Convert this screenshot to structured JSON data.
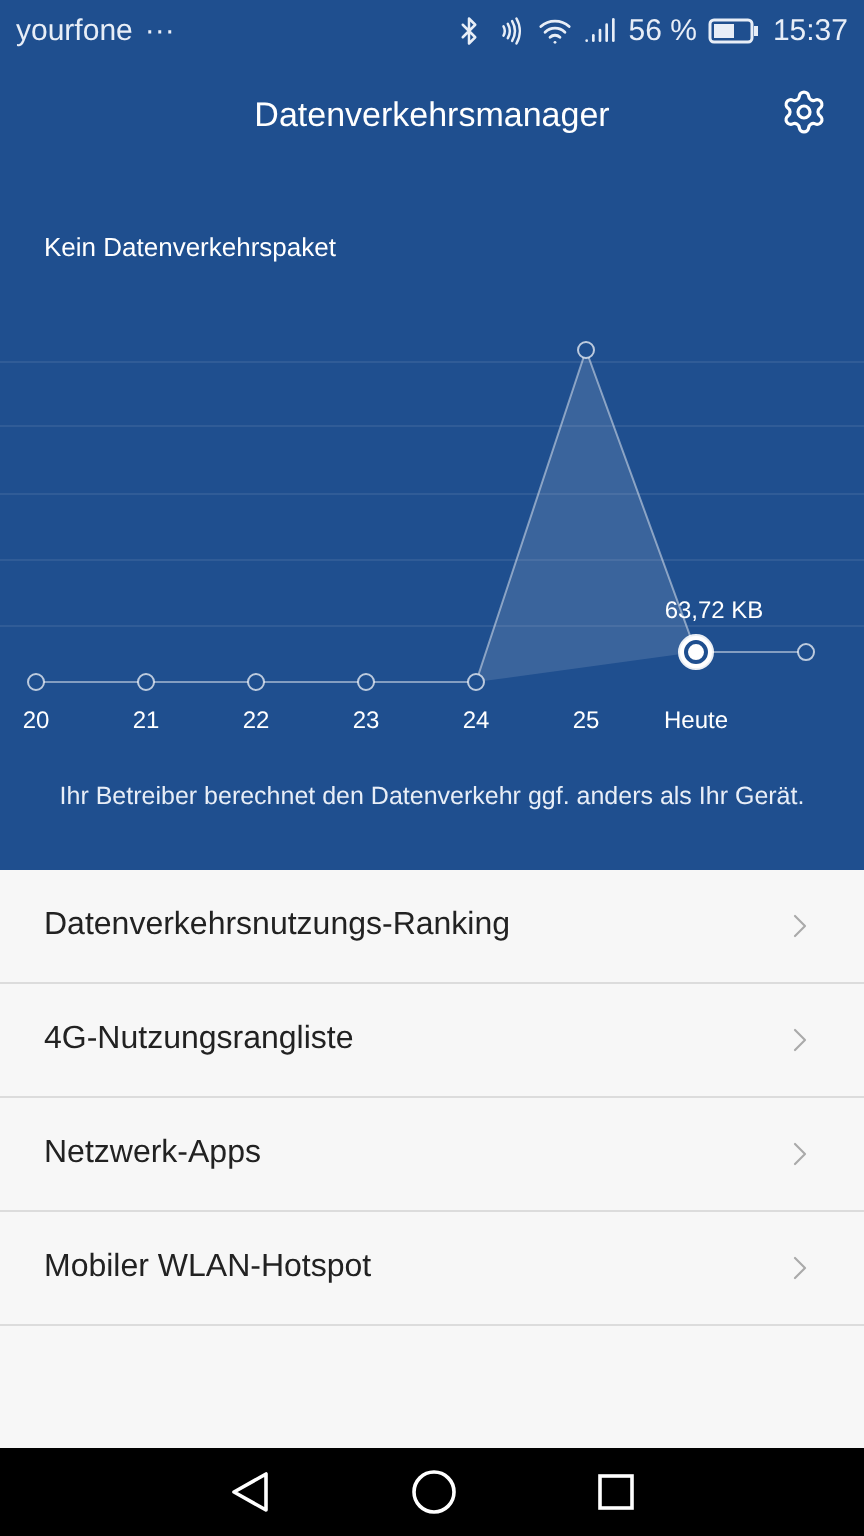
{
  "status_bar": {
    "carrier": "yourfone",
    "overflow": "···",
    "battery_percent": "56 %",
    "time": "15:37"
  },
  "header": {
    "title": "Datenverkehrsmanager"
  },
  "usage": {
    "plan_label": "Kein Datenverkehrspaket",
    "days": [
      {
        "label": "20",
        "selected": false
      },
      {
        "label": "21",
        "selected": false
      },
      {
        "label": "22",
        "selected": false
      },
      {
        "label": "23",
        "selected": false
      },
      {
        "label": "24",
        "selected": false
      },
      {
        "label": "25",
        "selected": false
      },
      {
        "label": "Heute",
        "selected": true
      }
    ],
    "selected_value": "63,72 KB",
    "note": "Ihr Betreiber berechnet den Datenverkehr ggf. anders als Ihr Gerät."
  },
  "menu": [
    {
      "label": "Datenverkehrsnutzungs-Ranking"
    },
    {
      "label": "4G-Nutzungsrangliste"
    },
    {
      "label": "Netzwerk-Apps"
    },
    {
      "label": "Mobiler WLAN-Hotspot"
    }
  ]
}
